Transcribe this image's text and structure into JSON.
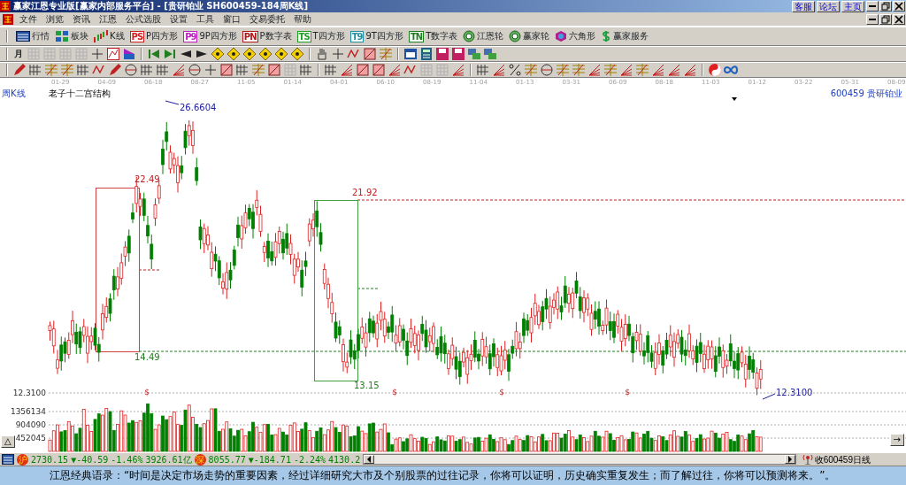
{
  "window": {
    "title": "赢家江恩专业版[赢家内部服务平台] - [贵研铂业   SH600459-184周K线]",
    "links": [
      "客服",
      "论坛",
      "主页"
    ]
  },
  "menu": {
    "items": [
      "文件",
      "浏览",
      "资讯",
      "江恩",
      "公式选股",
      "设置",
      "工具",
      "窗口",
      "交易委托",
      "帮助"
    ]
  },
  "toolbar": {
    "items": [
      {
        "label": "行情"
      },
      {
        "label": "板块"
      },
      {
        "label": "K线"
      },
      {
        "label": "P四方形",
        "badge": "PS",
        "color": "#d02020"
      },
      {
        "label": "9P四方形",
        "badge": "P9",
        "color": "#c020c0"
      },
      {
        "label": "P数字表",
        "badge": "PN",
        "color": "#b01818"
      },
      {
        "label": "T四方形",
        "badge": "TS",
        "color": "#20a020"
      },
      {
        "label": "9T四方形",
        "badge": "T9",
        "color": "#2090a0"
      },
      {
        "label": "T数字表",
        "badge": "TN",
        "color": "#208020"
      },
      {
        "label": "江恩轮"
      },
      {
        "label": "赢家轮"
      },
      {
        "label": "六角形"
      },
      {
        "label": "赢家服务"
      }
    ]
  },
  "period_selector": "月",
  "chart": {
    "period": "周K线",
    "title": "老子十二宫结构",
    "code": "600459",
    "name": "贵研铂业",
    "dates": [
      "01-29",
      "04-09",
      "06-18",
      "08-27",
      "11-05",
      "01-14",
      "04-01",
      "06-10",
      "08-19",
      "11-04",
      "01-13",
      "03-31",
      "06-09",
      "08-18",
      "11-03",
      "01-12",
      "03-22",
      "05-31",
      "08-09"
    ],
    "annotations": [
      {
        "text": "26.6604",
        "color": "#2020a0"
      },
      {
        "text": "22.49",
        "color": "#c02020"
      },
      {
        "text": "14.49",
        "color": "#208020"
      },
      {
        "text": "21.92",
        "color": "#c02020"
      },
      {
        "text": "13.15",
        "color": "#208020"
      },
      {
        "text": "12.3100",
        "color": "#2020a0"
      }
    ],
    "signal_marks": [
      "$",
      "$",
      "$",
      "$"
    ],
    "volume_labels": [
      "12.3100",
      "1356134",
      "904090",
      "452045"
    ],
    "collapse_button": "△",
    "scroll_right_button": "→"
  },
  "status_bar": {
    "indices": [
      {
        "badge": "沪",
        "value": "2730.15",
        "change": "▼-40.59",
        "percent": "-1.46%",
        "amount": "3926.61亿"
      },
      {
        "badge": "深",
        "value": "8055.77",
        "change": "▼-184.71",
        "percent": "-2.24%",
        "amount": "4130.2"
      }
    ],
    "message": "收600459日线"
  },
  "quote": "江恩经典语录：“时间是决定市场走势的重要因素，经过详细研究大市及个别股票的过往记录，你将可以证明，历史确实重复发生；而了解过往，你将可以预测将来。”。"
}
